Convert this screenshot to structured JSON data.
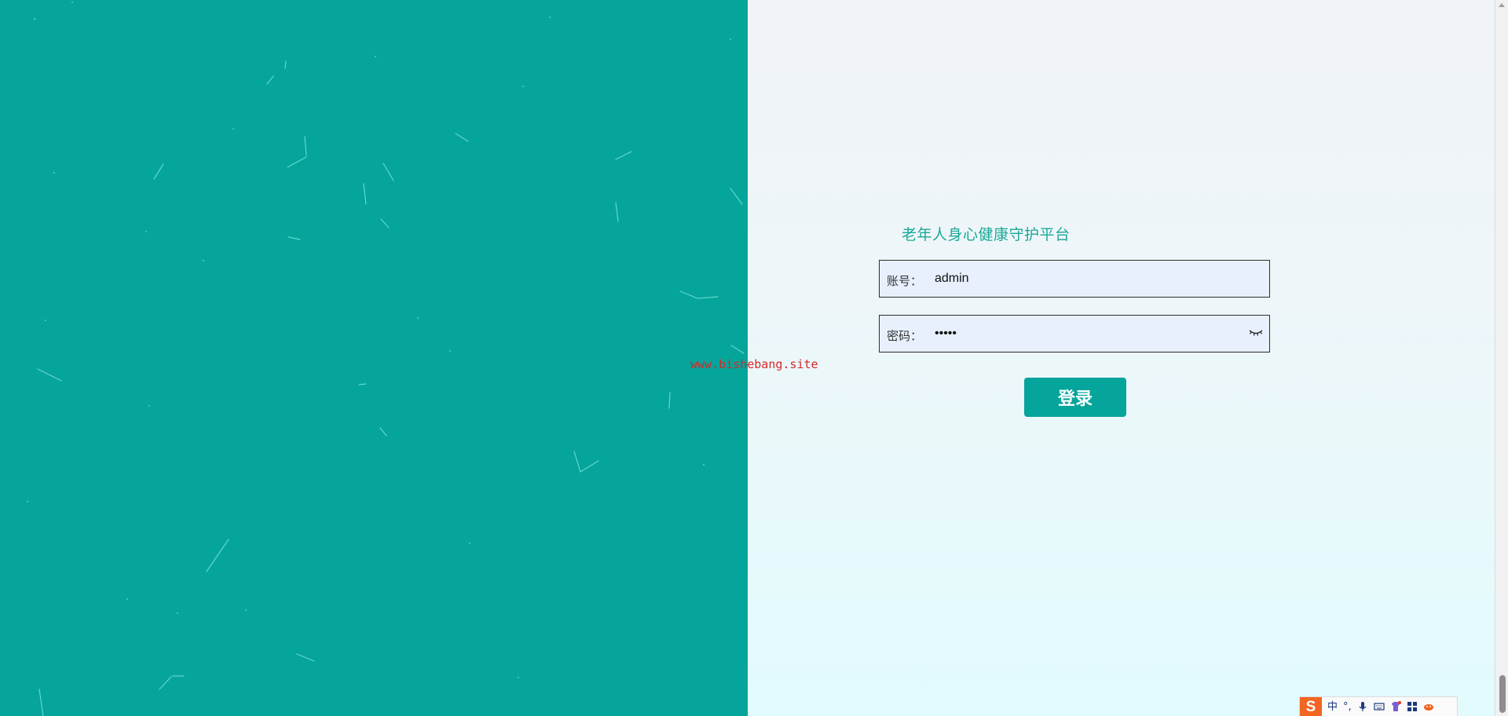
{
  "login": {
    "title": "老年人身心健康守护平台",
    "account_label": "账号：",
    "account_value": "admin",
    "password_label": "密码：",
    "password_value": "•••••",
    "button_label": "登录"
  },
  "watermark": "www.bishebang.site",
  "ime": {
    "logo": "S",
    "mode": "中",
    "punctuation": "°,"
  },
  "colors": {
    "primary": "#06a59b",
    "background_top": "#f0f3f8",
    "background_bottom": "#e2fbfd",
    "watermark": "#d42a2a"
  }
}
